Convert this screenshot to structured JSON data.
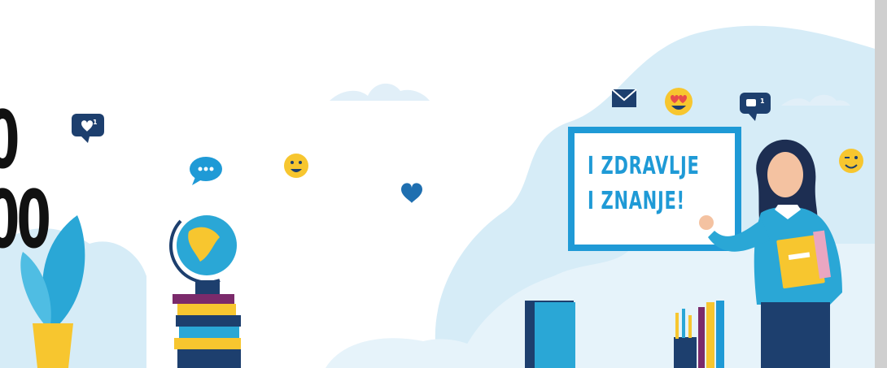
{
  "banner": {
    "left_text": [
      "0",
      "00"
    ],
    "whiteboard_lines": [
      "I ZDRAVLJE",
      "I ZNANJE!"
    ],
    "notification_counts": [
      "1",
      "1"
    ]
  },
  "colors": {
    "background": "#ffffff",
    "cloud": "#d6ecf7",
    "cloud_light": "#e6f3fa",
    "accent_blue": "#1f9ad6",
    "navy": "#1d3f6e",
    "yellow": "#f7c62f",
    "right_border": "#cfcfcf"
  },
  "icons": [
    "heart-badge-icon",
    "chat-bubble-icon",
    "smile-emoji-icon",
    "heart-icon",
    "envelope-icon",
    "heart-eyes-emoji-icon",
    "chat-badge-icon",
    "wink-emoji-icon"
  ]
}
